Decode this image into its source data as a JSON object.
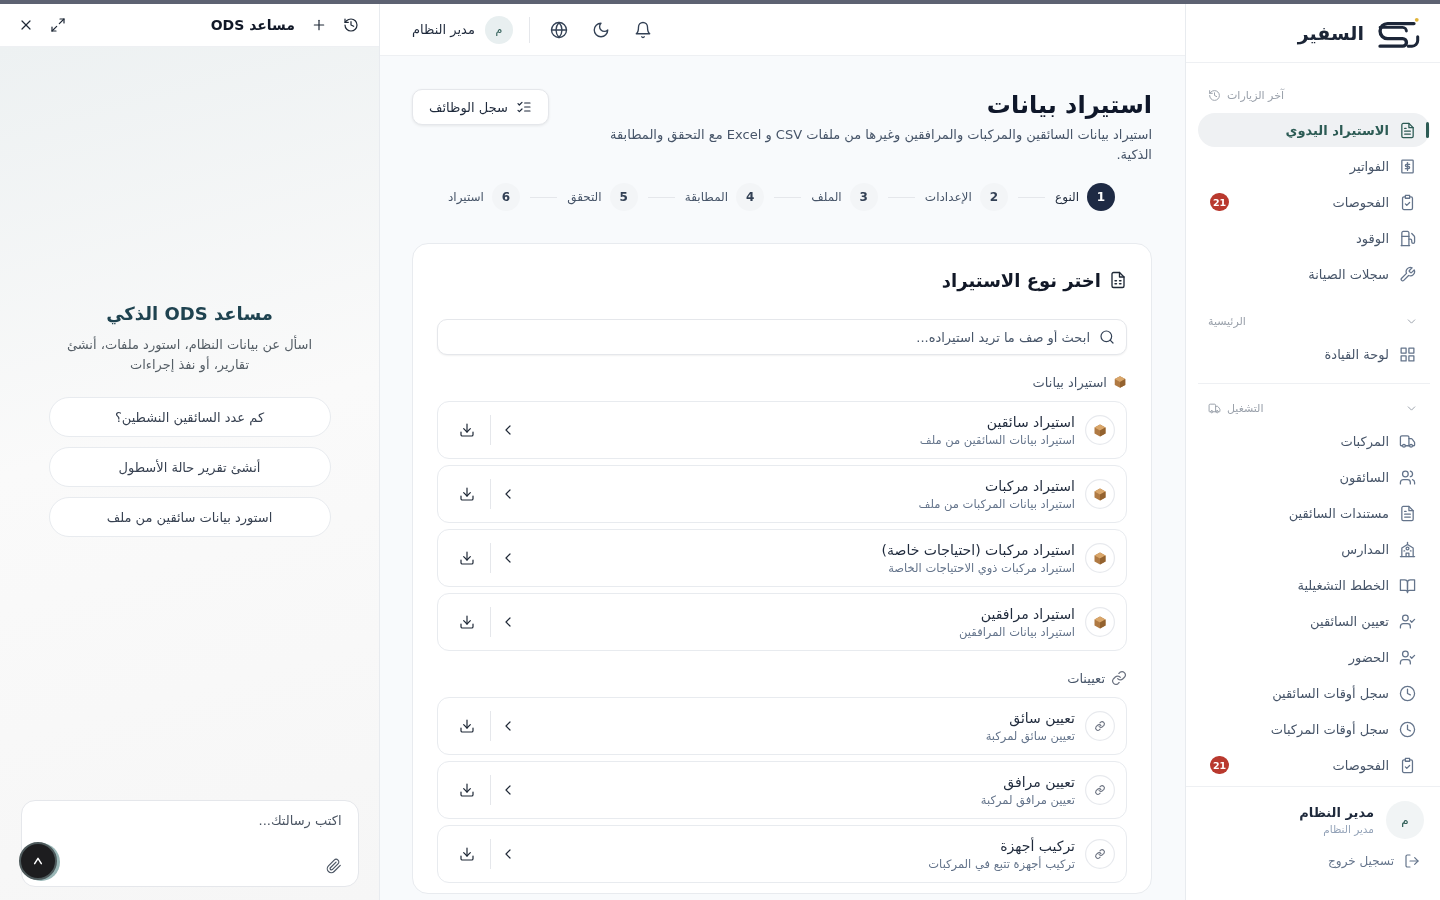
{
  "assistant": {
    "title": "مساعد ODS",
    "heading": "مساعد ODS الذكي",
    "description": "اسأل عن بيانات النظام، استورد ملفات، أنشئ تقارير، أو نفذ إجراءات",
    "suggestions": [
      "كم عدد السائقين النشطين؟",
      "أنشئ تقرير حالة الأسطول",
      "استورد بيانات سائقين من ملف"
    ],
    "message": {
      "placeholder": "اكتب رسالتك..."
    }
  },
  "topbar": {
    "user": {
      "avatar": "م",
      "name": "مدير النظام"
    }
  },
  "page": {
    "title": "استيراد بيانات",
    "description": "استيراد بيانات السائقين والمركبات والمرافقين وغيرها من ملفات CSV و Excel مع التحقق والمطابقة الذكية.",
    "jobs_button": "سجل الوظائف"
  },
  "steps": [
    {
      "number": "1",
      "label": "النوع",
      "selected": true
    },
    {
      "number": "2",
      "label": "الإعدادات",
      "selected": false
    },
    {
      "number": "3",
      "label": "الملف",
      "selected": false
    },
    {
      "number": "4",
      "label": "المطابقة",
      "selected": false
    },
    {
      "number": "5",
      "label": "التحقق",
      "selected": false
    },
    {
      "number": "6",
      "label": "استيراد",
      "selected": false
    }
  ],
  "import_card": {
    "title": "اختر نوع الاستيراد",
    "search": {
      "placeholder": "ابحث أو صف ما تريد استيراده..."
    },
    "sections": [
      {
        "kind": "import",
        "label": "استيراد بيانات",
        "items": [
          {
            "title": "استيراد سائقين",
            "subtitle": "استيراد بيانات السائقين من ملف"
          },
          {
            "title": "استيراد مركبات",
            "subtitle": "استيراد بيانات المركبات من ملف"
          },
          {
            "title": "استيراد مركبات (احتياجات خاصة)",
            "subtitle": "استيراد مركبات ذوي الاحتياجات الخاصة"
          },
          {
            "title": "استيراد مرافقين",
            "subtitle": "استيراد بيانات المرافقين"
          }
        ]
      },
      {
        "kind": "assignment",
        "label": "تعيينات",
        "items": [
          {
            "title": "تعيين سائق",
            "subtitle": "تعيين سائق لمركبة"
          },
          {
            "title": "تعيين مرافق",
            "subtitle": "تعيين مرافق لمركبة"
          },
          {
            "title": "تركيب أجهزة",
            "subtitle": "تركيب أجهزة تتبع في المركبات"
          }
        ]
      }
    ]
  },
  "sidebar": {
    "brand": "السفير",
    "recent": {
      "label": "آخر الزيارات",
      "items": [
        {
          "label": "الاستيراد اليدوي",
          "selected": true
        },
        {
          "label": "الفواتير",
          "selected": false
        },
        {
          "label": "الفحوصات",
          "selected": false,
          "badge": "21"
        },
        {
          "label": "الوقود",
          "selected": false
        },
        {
          "label": "سجلات الصيانة",
          "selected": false
        }
      ]
    },
    "groups": [
      {
        "label": "الرئيسية",
        "expanded": true,
        "items": [
          {
            "label": "لوحة القيادة",
            "selected": false
          }
        ]
      },
      {
        "label": "التشغيل",
        "expanded": true,
        "items": [
          {
            "label": "المركبات",
            "selected": false
          },
          {
            "label": "السائقون",
            "selected": false
          },
          {
            "label": "مستندات السائقين",
            "selected": false
          },
          {
            "label": "المدارس",
            "selected": false
          },
          {
            "label": "الخطط التشغيلية",
            "selected": false
          },
          {
            "label": "تعيين السائقين",
            "selected": false
          },
          {
            "label": "الحضور",
            "selected": false
          },
          {
            "label": "سجل أوقات السائقين",
            "selected": false
          },
          {
            "label": "سجل أوقات المركبات",
            "selected": false
          },
          {
            "label": "الفحوصات",
            "selected": false,
            "badge": "21"
          }
        ]
      }
    ],
    "user": {
      "avatar": "م",
      "name": "مدير النظام",
      "role": "مدير النظام"
    },
    "logout": "تسجيل خروج"
  }
}
